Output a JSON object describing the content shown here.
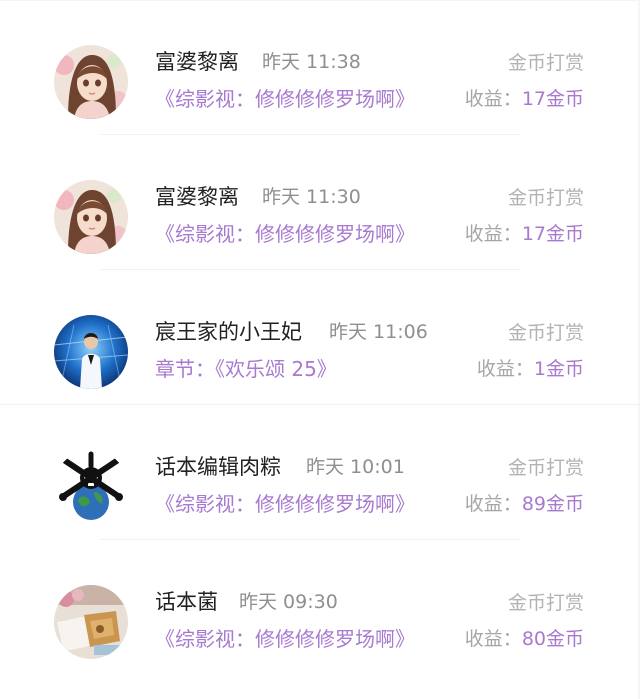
{
  "records": [
    {
      "avatar": "avatar-anime-girl",
      "user": "富婆黎离",
      "time": "昨天 11:38",
      "type": "金币打赏",
      "work": "《综影视：修修修修罗场啊》",
      "income_label": "收益：",
      "income_value": "17金币"
    },
    {
      "avatar": "avatar-anime-girl",
      "user": "富婆黎离",
      "time": "昨天 11:30",
      "type": "金币打赏",
      "work": "《综影视：修修修修罗场啊》",
      "income_label": "收益：",
      "income_value": "17金币"
    },
    {
      "avatar": "avatar-performer-stage",
      "user": "宸王家的小王妃",
      "time": "昨天 11:06",
      "type": "金币打赏",
      "work": "章节：《欢乐颂 25》",
      "income_label": "收益：",
      "income_value": "1金币"
    },
    {
      "avatar": "avatar-skull-globe",
      "user": "话本编辑肉粽",
      "time": "昨天 10:01",
      "type": "金币打赏",
      "work": "《综影视：修修修修罗场啊》",
      "income_label": "收益：",
      "income_value": "89金币"
    },
    {
      "avatar": "avatar-food-photo",
      "user": "话本菌",
      "time": "昨天 09:30",
      "type": "金币打赏",
      "work": "《综影视：修修修修罗场啊》",
      "income_label": "收益：",
      "income_value": "80金币"
    }
  ],
  "colors": {
    "accent_purple": "#a77ad0",
    "name_text": "#222222",
    "muted_text": "#8f8f8f",
    "type_text": "#b3b3b3"
  }
}
